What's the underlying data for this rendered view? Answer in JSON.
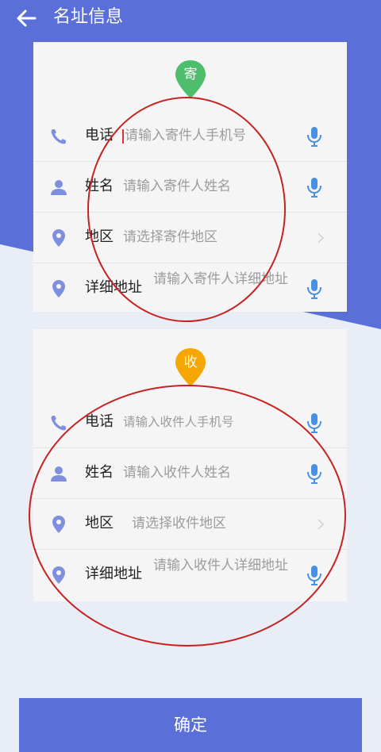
{
  "header": {
    "title": "名址信息"
  },
  "sender": {
    "badge": "寄",
    "rows": [
      {
        "label": "电话",
        "placeholder": "请输入寄件人手机号"
      },
      {
        "label": "姓名",
        "placeholder": "请输入寄件人姓名"
      },
      {
        "label": "地区",
        "placeholder": "请选择寄件地区"
      },
      {
        "label": "详细地址",
        "placeholder": "请输入寄件人详细地址"
      }
    ]
  },
  "receiver": {
    "badge": "收",
    "rows": [
      {
        "label": "电话",
        "placeholder": "请输入收件人手机号"
      },
      {
        "label": "姓名",
        "placeholder": "请输入收件人姓名"
      },
      {
        "label": "地区",
        "placeholder": "请选择收件地区"
      },
      {
        "label": "详细地址",
        "placeholder": "请输入收件人详细地址"
      }
    ]
  },
  "confirm_label": "确定",
  "colors": {
    "primary": "#5a6fd8",
    "icon": "#7f8fe0",
    "mic": "#4a90e2",
    "send_badge": "#4cbe6c",
    "recv_badge": "#f5a600",
    "annotation": "#c62222"
  }
}
